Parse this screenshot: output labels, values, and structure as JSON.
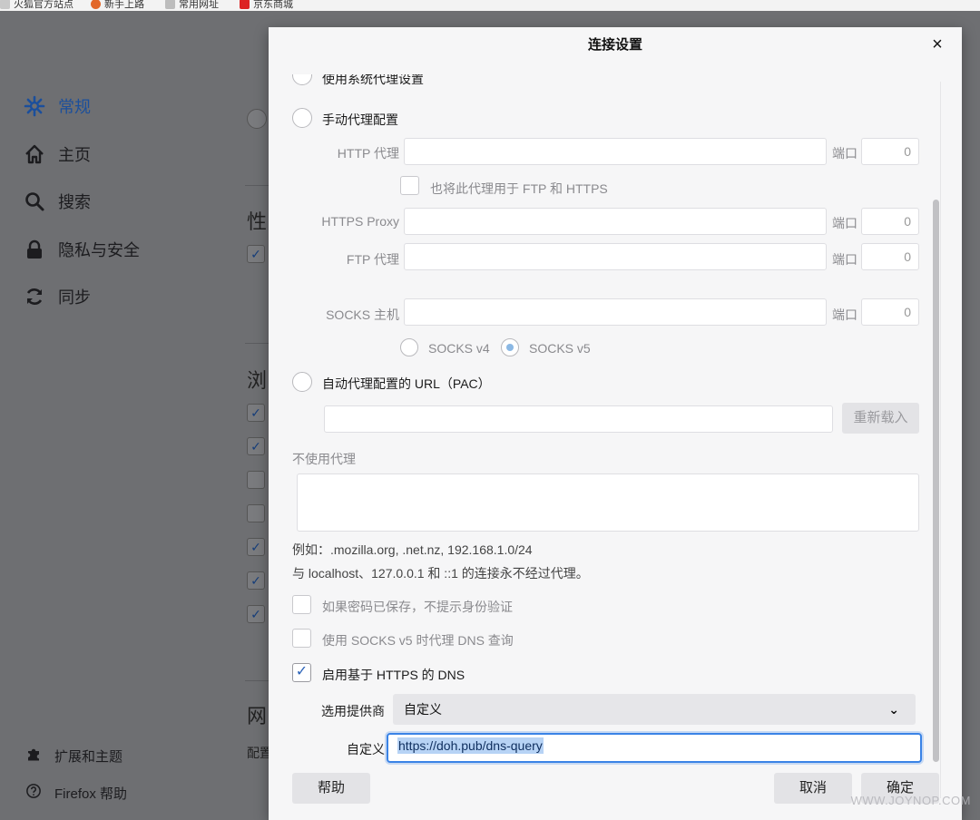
{
  "bookmarks": [
    {
      "label": "火狐官方站点",
      "color": "#c9c9c9"
    },
    {
      "label": "新手上路",
      "color": "#e2682a"
    },
    {
      "label": "常用网址",
      "color": "#bdbdbd"
    },
    {
      "label": "京东商城",
      "color": "#d22"
    }
  ],
  "sidebar": {
    "items": [
      {
        "label": "常规",
        "icon": "gear-icon"
      },
      {
        "label": "主页",
        "icon": "home-icon"
      },
      {
        "label": "搜索",
        "icon": "search-icon"
      },
      {
        "label": "隐私与安全",
        "icon": "lock-icon"
      },
      {
        "label": "同步",
        "icon": "sync-icon"
      }
    ],
    "footer": [
      {
        "label": "扩展和主题",
        "icon": "puzzle-icon"
      },
      {
        "label": "Firefox 帮助",
        "icon": "help-icon"
      }
    ]
  },
  "background": {
    "heading_1": "性",
    "heading_2": "浏",
    "heading_3": "网",
    "text_1": "配置"
  },
  "dialog": {
    "title": "连接设置",
    "close": "×",
    "system_proxy_label": "使用系统代理设置",
    "manual_proxy_label": "手动代理配置",
    "http_proxy_label": "HTTP 代理",
    "port_label": "端口",
    "http_port": "0",
    "also_use_label": "也将此代理用于 FTP 和 HTTPS",
    "https_proxy_label": "HTTPS Proxy",
    "https_port": "0",
    "ftp_proxy_label": "FTP 代理",
    "ftp_port": "0",
    "socks_host_label": "SOCKS 主机",
    "socks_port": "0",
    "socks_v4_label": "SOCKS v4",
    "socks_v5_label": "SOCKS v5",
    "pac_label": "自动代理配置的 URL（PAC）",
    "reload_label": "重新载入",
    "no_proxy_label": "不使用代理",
    "example_note": "例如：.mozilla.org, .net.nz, 192.168.1.0/24",
    "localhost_note": "与 localhost、127.0.0.1 和 ::1 的连接永不经过代理。",
    "no_auth_prompt_label": "如果密码已保存，不提示身份验证",
    "socks_dns_label": "使用 SOCKS v5 时代理 DNS 查询",
    "doh_label": "启用基于 HTTPS 的 DNS",
    "provider_label": "选用提供商",
    "provider_value": "自定义",
    "custom_label": "自定义",
    "custom_value": "https://doh.pub/dns-query",
    "help_button": "帮助",
    "cancel_button": "取消",
    "ok_button": "确定"
  },
  "watermark": "WWW.JOYNOP.COM"
}
